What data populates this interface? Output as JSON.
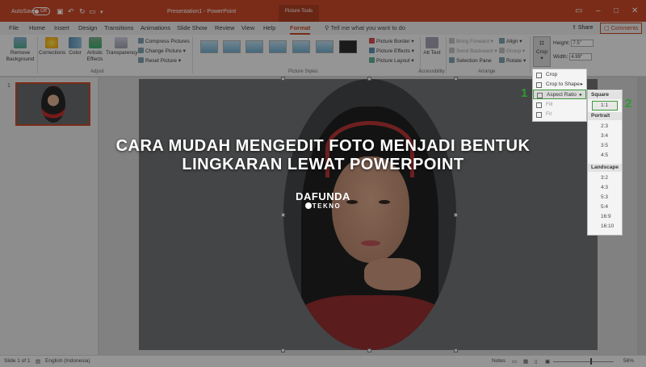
{
  "titlebar": {
    "autosave": "AutoSave",
    "toggle": "Off",
    "document": "Presentation1 - PowerPoint",
    "context_tab": "Picture Tools"
  },
  "tabs": [
    "File",
    "Home",
    "Insert",
    "Design",
    "Transitions",
    "Animations",
    "Slide Show",
    "Review",
    "View",
    "Help",
    "Format"
  ],
  "tell_me": "Tell me what you want to do",
  "share": "Share",
  "comments": "Comments",
  "ribbon": {
    "remove_background": "Remove Background",
    "corrections": "Corrections",
    "color": "Color",
    "artistic_effects": "Artistic Effects",
    "transparency": "Transparency",
    "compress": "Compress Pictures",
    "change": "Change Picture",
    "reset": "Reset Picture",
    "adjust_label": "Adjust",
    "styles_label": "Picture Styles",
    "picture_border": "Picture Border",
    "picture_effects": "Picture Effects",
    "picture_layout": "Picture Layout",
    "alt_text": "Alt Text",
    "accessibility_label": "Accessibility",
    "bring_forward": "Bring Forward",
    "send_backward": "Send Backward",
    "selection_pane": "Selection Pane",
    "align": "Align",
    "group": "Group",
    "rotate": "Rotate",
    "arrange_label": "Arrange",
    "crop": "Crop",
    "height_label": "Height:",
    "height_value": "7.5\"",
    "width_label": "Width:",
    "width_value": "4.99\""
  },
  "crop_menu": [
    "Crop",
    "Crop to Shape",
    "Aspect Ratio",
    "Fill",
    "Fit"
  ],
  "aspect_menu": {
    "square_label": "Square",
    "square": [
      "1:1"
    ],
    "portrait_label": "Portrait",
    "portrait": [
      "2:3",
      "3:4",
      "3:5",
      "4:5"
    ],
    "landscape_label": "Landscape",
    "landscape": [
      "3:2",
      "4:3",
      "5:3",
      "5:4",
      "16:9",
      "16:10"
    ]
  },
  "steps": [
    "1",
    "2"
  ],
  "slide_number": "1",
  "headline": "CARA MUDAH MENGEDIT FOTO MENJADI BENTUK LINGKARAN LEWAT POWERPOINT",
  "watermark": {
    "line1": "DAFUNDA",
    "line2": "TEKNO"
  },
  "status": {
    "slide": "Slide 1 of 1",
    "language": "English (Indonesia)",
    "notes": "Notes",
    "zoom": "56%"
  },
  "colors": {
    "accent": "#c43e1c",
    "highlight": "#3c9a3c"
  }
}
